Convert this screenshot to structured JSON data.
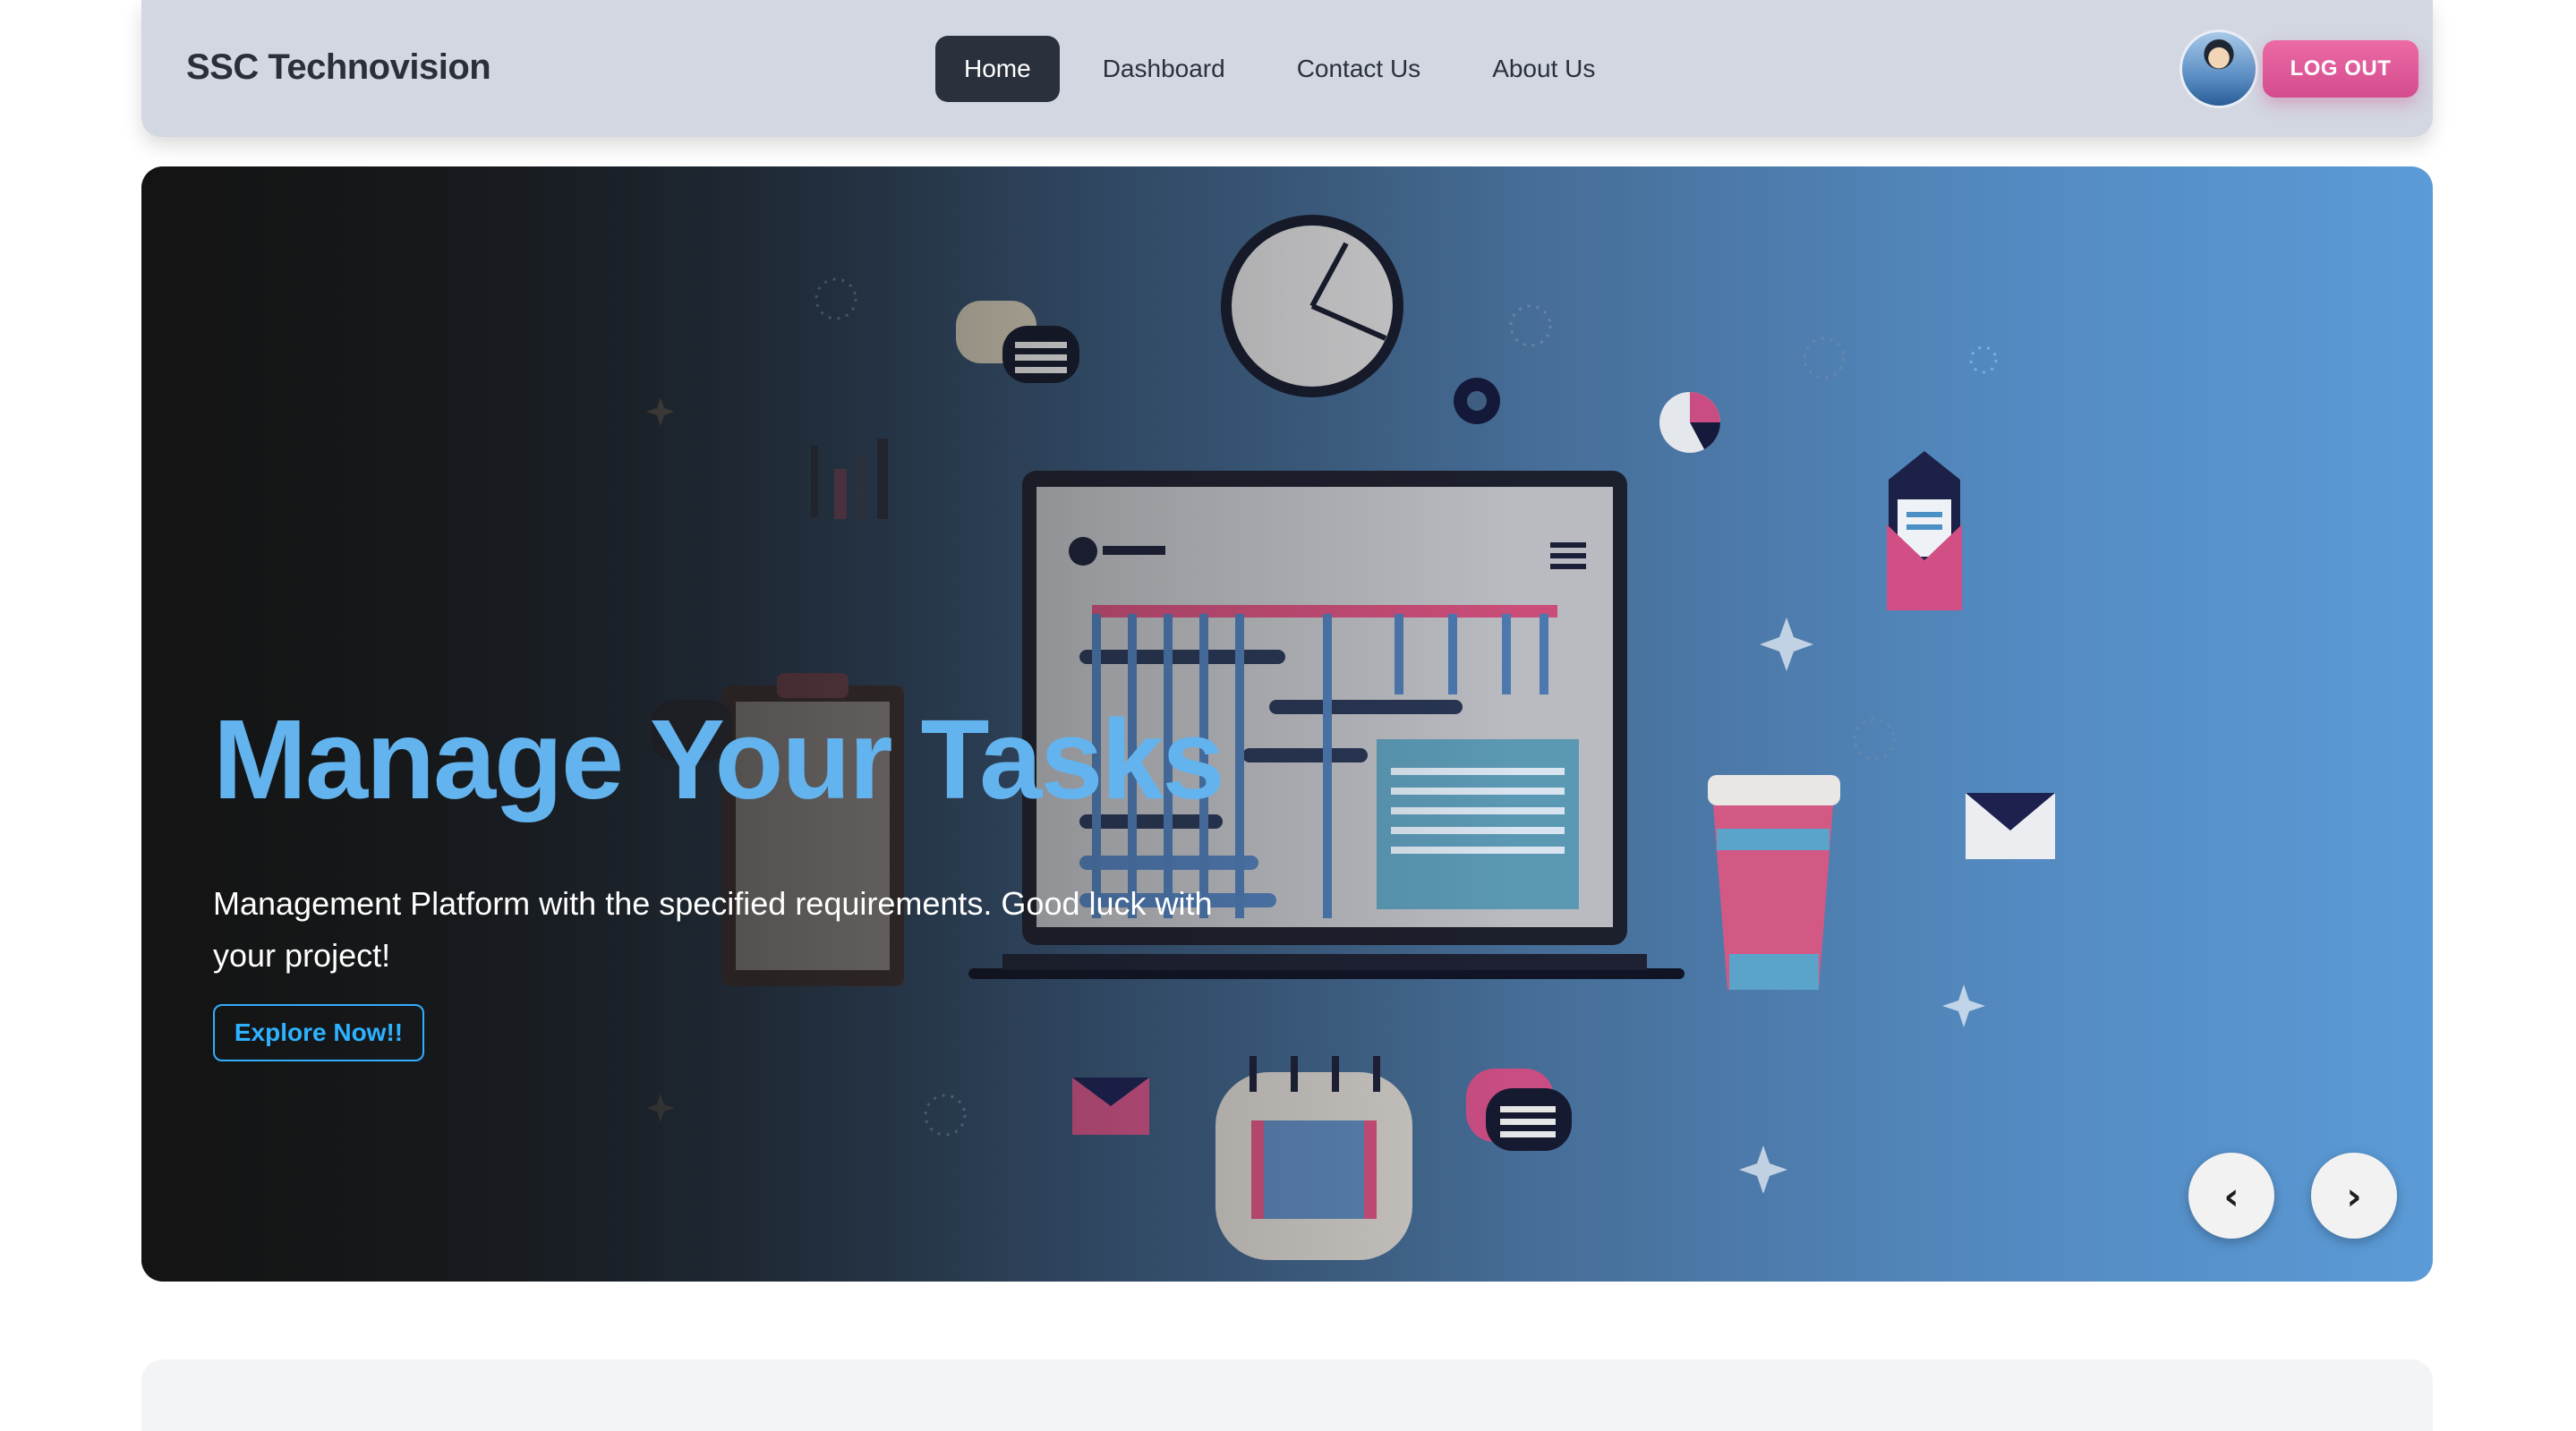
{
  "header": {
    "brand": "SSC Technovision",
    "nav": [
      {
        "label": "Home",
        "active": true
      },
      {
        "label": "Dashboard",
        "active": false
      },
      {
        "label": "Contact Us",
        "active": false
      },
      {
        "label": "About Us",
        "active": false
      }
    ],
    "logout_label": "LOG OUT"
  },
  "hero": {
    "title": "Manage Your Tasks",
    "text": "Management Platform with the specified requirements. Good luck with your project!",
    "cta_label": "Explore Now!!",
    "prev_icon": "‹",
    "next_icon": "›"
  },
  "colors": {
    "navbar_bg": "#d2d7e1",
    "active_nav_bg": "#2b313c",
    "logout_bg": "#e05b9a",
    "title_color": "#63b3ee",
    "cta_color": "#2eb2ff"
  }
}
